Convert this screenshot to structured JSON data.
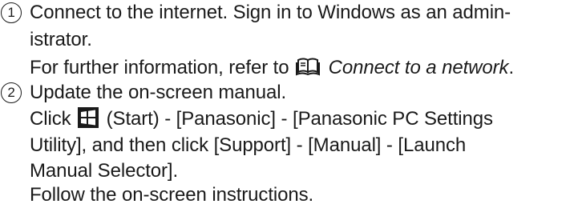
{
  "steps": [
    {
      "number": "1",
      "line1": "Connect to the internet. Sign in to Windows as an admin-",
      "line2": "istrator.",
      "line3_prefix": "For further information, refer to",
      "line3_link": "Connect to a network",
      "line3_suffix": ".",
      "link_icon": "book-icon"
    },
    {
      "number": "2",
      "line1": "Update the on-screen manual.",
      "line2_prefix": "Click",
      "line2_icon": "windows-start-icon",
      "line2_suffix": "(Start) - [Panasonic] - [Panasonic PC Settings",
      "line3": "Utility], and then click [Support] - [Manual] - [Launch",
      "line4": "Manual Selector].",
      "line5": "Follow the on-screen instructions."
    }
  ]
}
